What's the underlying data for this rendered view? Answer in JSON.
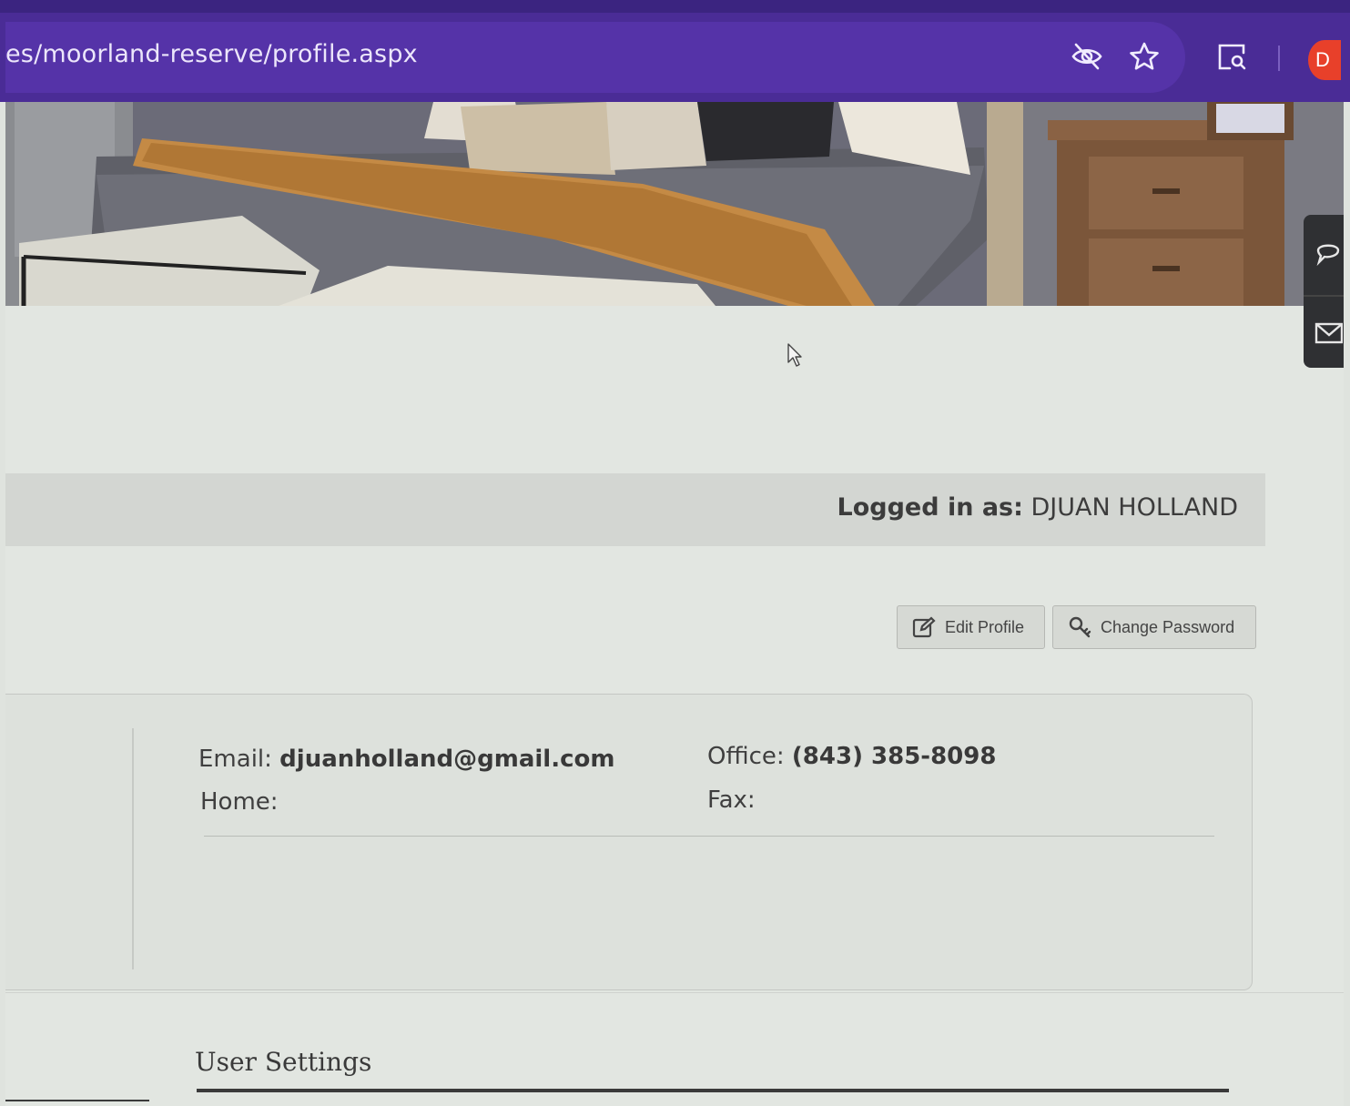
{
  "browser": {
    "url": "es/moorland-reserve/profile.aspx",
    "profile_initial": "D",
    "icons": [
      "eye-off-icon",
      "star-icon",
      "screen-search-icon"
    ]
  },
  "side_widget": {
    "icons": [
      "chat-icon",
      "mail-icon"
    ]
  },
  "header": {
    "logged_in_label": "Logged in as:",
    "user_name": "DJUAN HOLLAND"
  },
  "actions": {
    "edit_profile": "Edit Profile",
    "change_password": "Change Password"
  },
  "contact": {
    "email_label": "Email:",
    "email_value": "djuanholland@gmail.com",
    "home_label": "Home:",
    "home_value": "",
    "office_label": "Office:",
    "office_value": "(843) 385-8098",
    "fax_label": "Fax:",
    "fax_value": ""
  },
  "sections": {
    "user_settings": "User Settings"
  },
  "colors": {
    "browser_chrome": "#4a2c96",
    "address_bar": "#5533a8",
    "avatar": "#e8402a",
    "page_bg": "#e2e6e1"
  }
}
